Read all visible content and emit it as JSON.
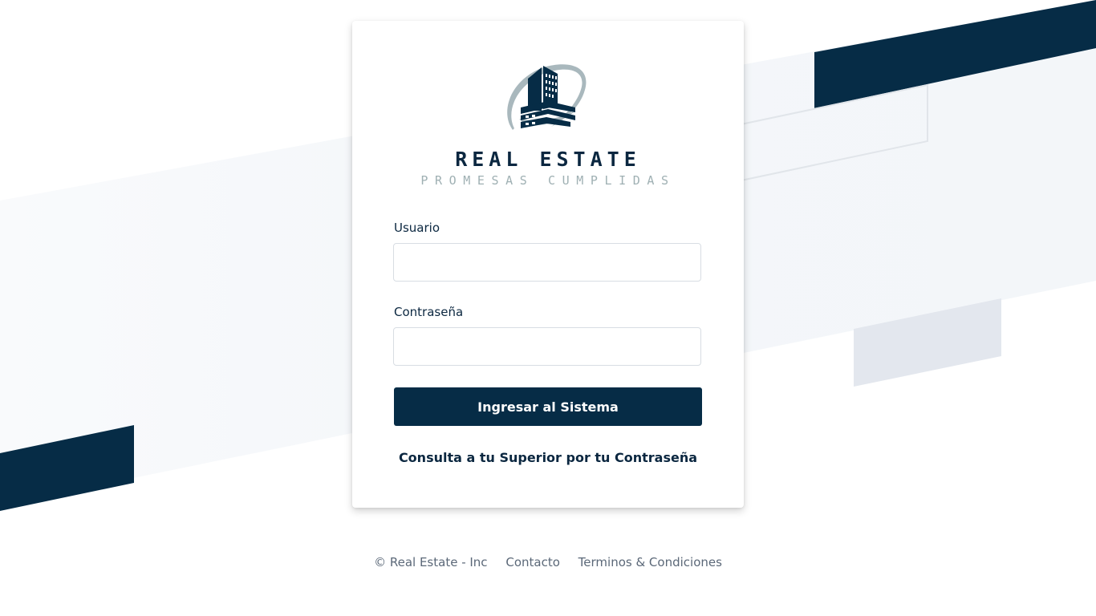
{
  "brand": {
    "name": "REAL ESTATE",
    "tagline": "PROMESAS CUMPLIDAS",
    "logo_icon": "building-logo-icon"
  },
  "login": {
    "username_label": "Usuario",
    "username_value": "",
    "password_label": "Contraseña",
    "password_value": "",
    "submit_label": "Ingresar al Sistema",
    "help_text": "Consulta a tu Superior por tu Contraseña"
  },
  "footer": {
    "copyright": "© Real Estate - Inc",
    "contact": "Contacto",
    "terms": "Terminos & Condiciones"
  },
  "colors": {
    "primary": "#062c46",
    "accent_light": "#9fb0b3",
    "background_band": "#f4f7fa",
    "grey_block": "#e3e7ee",
    "footer_text": "#5b6878"
  }
}
